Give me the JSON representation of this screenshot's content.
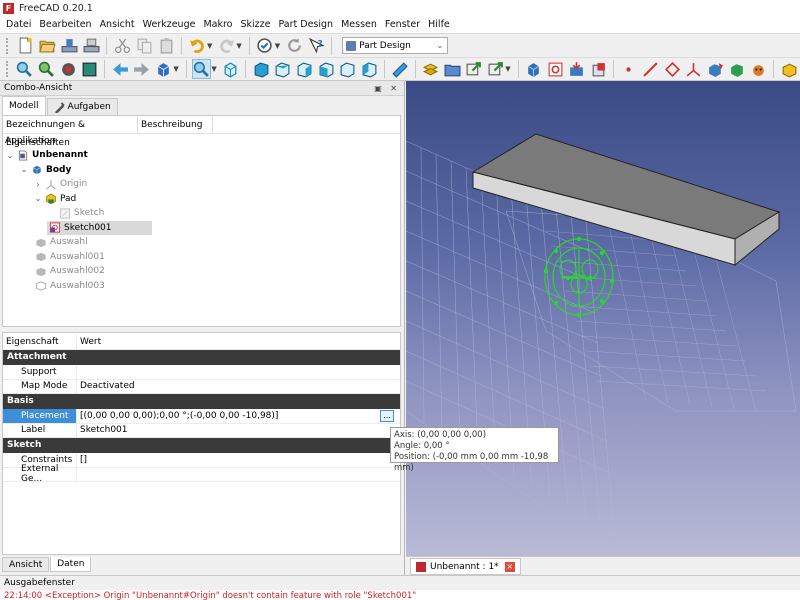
{
  "window": {
    "title": "FreeCAD 0.20.1"
  },
  "menu": [
    "Datei",
    "Bearbeiten",
    "Ansicht",
    "Werkzeuge",
    "Makro",
    "Skizze",
    "Part Design",
    "Messen",
    "Fenster",
    "Hilfe"
  ],
  "toolbar": {
    "workbench": "Part Design"
  },
  "combo": {
    "title": "Combo-Ansicht",
    "tabs": [
      "Modell",
      "Aufgaben"
    ],
    "tree_headers": [
      "Bezeichnungen & Eigenschaften",
      "Beschreibung"
    ],
    "tree_root": "Applikation",
    "tree": [
      {
        "label": "Unbenannt",
        "expander": "⌄"
      },
      {
        "label": "Body",
        "expander": "⌄"
      },
      {
        "label": "Origin",
        "expander": "›"
      },
      {
        "label": "Pad",
        "expander": "⌄"
      },
      {
        "label": "Sketch"
      },
      {
        "label": "Sketch001"
      },
      {
        "label": "Auswahl"
      },
      {
        "label": "Auswahl001"
      },
      {
        "label": "Auswahl002"
      },
      {
        "label": "Auswahl003"
      }
    ]
  },
  "properties": {
    "headers": [
      "Eigenschaft",
      "Wert"
    ],
    "groups": [
      "Attachment",
      "Basis",
      "Sketch"
    ],
    "rows": [
      {
        "name": "Support",
        "value": ""
      },
      {
        "name": "Map Mode",
        "value": "Deactivated"
      },
      {
        "name": "Placement",
        "value": "[(0,00 0,00 0,00);0,00 °;(-0,00 0,00 -10,98)]",
        "expander": "›"
      },
      {
        "name": "Label",
        "value": "Sketch001"
      },
      {
        "name": "Constraints",
        "value": "[]"
      },
      {
        "name": "External Ge...",
        "value": ""
      }
    ],
    "ellipsis": "..."
  },
  "bottom_tabs": [
    "Ansicht",
    "Daten"
  ],
  "tooltip": {
    "axis": "Axis: (0,00 0,00 0,00)",
    "angle": "Angle: 0,00 °",
    "position": "Position: (-0,00 mm  0,00 mm  -10,98 mm)"
  },
  "viewport": {
    "tab": "Unbenannt : 1*",
    "close": "×"
  },
  "output": {
    "title": "Ausgabefenster",
    "log": "22:14:00  <Exception> Origin \"Unbenannt#Origin\" doesn't contain feature with role \"Sketch001\""
  },
  "icons": [
    "new-document-icon",
    "open-icon",
    "save-icon",
    "print-icon",
    "cut-icon",
    "copy-icon",
    "paste-icon",
    "undo-icon",
    "redo-icon",
    "refresh-icon",
    "help-icon",
    "part-design-icon"
  ],
  "colors": {
    "accent": "#3e8fd8",
    "group_header": "#3a3a3a",
    "sketch_green": "#22dd22",
    "error": "#d02020"
  }
}
